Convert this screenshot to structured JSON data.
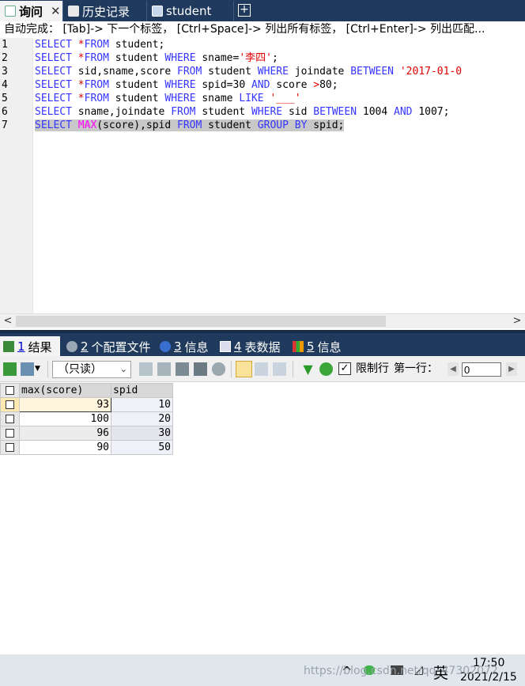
{
  "tabs": [
    {
      "label": "询问",
      "close": "✕"
    },
    {
      "label": "历史记录"
    },
    {
      "label": "student"
    }
  ],
  "add_tab": "+",
  "hint": "自动完成： [Tab]-> 下一个标签， [Ctrl+Space]-> 列出所有标签， [Ctrl+Enter]-> 列出匹配...",
  "editor": {
    "line_numbers": [
      "1",
      "2",
      "3",
      "4",
      "5",
      "6",
      "7"
    ],
    "lines": [
      [
        {
          "t": "SELECT ",
          "k": "kw"
        },
        {
          "t": "*",
          "k": "str"
        },
        {
          "t": "FROM ",
          "k": "kw"
        },
        {
          "t": "student;",
          "k": "txt"
        }
      ],
      [
        {
          "t": "SELECT ",
          "k": "kw"
        },
        {
          "t": "*",
          "k": "str"
        },
        {
          "t": "FROM ",
          "k": "kw"
        },
        {
          "t": "student ",
          "k": "txt"
        },
        {
          "t": "WHERE ",
          "k": "kw"
        },
        {
          "t": "sname=",
          "k": "txt"
        },
        {
          "t": "'李四'",
          "k": "str"
        },
        {
          "t": ";",
          "k": "txt"
        }
      ],
      [
        {
          "t": "SELECT ",
          "k": "kw"
        },
        {
          "t": "sid,sname,score ",
          "k": "txt"
        },
        {
          "t": "FROM ",
          "k": "kw"
        },
        {
          "t": "student ",
          "k": "txt"
        },
        {
          "t": "WHERE ",
          "k": "kw"
        },
        {
          "t": "joindate ",
          "k": "txt"
        },
        {
          "t": "BETWEEN ",
          "k": "kw"
        },
        {
          "t": "'2017-01-0",
          "k": "str"
        }
      ],
      [
        {
          "t": "SELECT ",
          "k": "kw"
        },
        {
          "t": "*",
          "k": "str"
        },
        {
          "t": "FROM ",
          "k": "kw"
        },
        {
          "t": "student ",
          "k": "txt"
        },
        {
          "t": "WHERE ",
          "k": "kw"
        },
        {
          "t": "spid=30 ",
          "k": "txt"
        },
        {
          "t": "AND ",
          "k": "kw"
        },
        {
          "t": "score ",
          "k": "txt"
        },
        {
          "t": ">",
          "k": "str"
        },
        {
          "t": "80;",
          "k": "txt"
        }
      ],
      [
        {
          "t": "SELECT ",
          "k": "kw"
        },
        {
          "t": "*",
          "k": "str"
        },
        {
          "t": "FROM ",
          "k": "kw"
        },
        {
          "t": "student ",
          "k": "txt"
        },
        {
          "t": "WHERE ",
          "k": "kw"
        },
        {
          "t": "sname ",
          "k": "txt"
        },
        {
          "t": "LIKE ",
          "k": "kw"
        },
        {
          "t": "'___'",
          "k": "str"
        }
      ],
      [
        {
          "t": "SELECT ",
          "k": "kw"
        },
        {
          "t": "sname,joindate ",
          "k": "txt"
        },
        {
          "t": "FROM ",
          "k": "kw"
        },
        {
          "t": "student ",
          "k": "txt"
        },
        {
          "t": "WHERE ",
          "k": "kw"
        },
        {
          "t": "sid ",
          "k": "txt"
        },
        {
          "t": "BETWEEN ",
          "k": "kw"
        },
        {
          "t": "1004 ",
          "k": "txt"
        },
        {
          "t": "AND ",
          "k": "kw"
        },
        {
          "t": "1007;",
          "k": "txt"
        }
      ],
      [
        {
          "t": "SELECT ",
          "k": "kw"
        },
        {
          "t": "MAX",
          "k": "fn"
        },
        {
          "t": "(score),spid ",
          "k": "txt"
        },
        {
          "t": "FROM ",
          "k": "kw"
        },
        {
          "t": "student ",
          "k": "txt"
        },
        {
          "t": "GROUP BY ",
          "k": "kw"
        },
        {
          "t": "spid;",
          "k": "txt"
        }
      ]
    ],
    "selected_line": 7
  },
  "scroll": {
    "left": "<",
    "right": ">"
  },
  "result_tabs": [
    {
      "num": "1",
      "label": "结果"
    },
    {
      "num": "2",
      "label": "个配置文件"
    },
    {
      "num": "3",
      "label": "信息"
    },
    {
      "num": "4",
      "label": "表数据"
    },
    {
      "num": "5",
      "label": "信息"
    }
  ],
  "toolbar": {
    "mode": "（只读）",
    "limit_label": "限制行",
    "first_row_label": "第一行：",
    "first_row_value": "0",
    "limit_checked": true
  },
  "grid": {
    "columns": [
      "max(score)",
      "spid"
    ],
    "rows": [
      [
        "93",
        "10"
      ],
      [
        "100",
        "20"
      ],
      [
        "96",
        "30"
      ],
      [
        "90",
        "50"
      ]
    ]
  },
  "taskbar": {
    "time": "17:50",
    "date": "2021/2/15",
    "ime": "英",
    "watermark": "https://blog.csdn.net/qq_47302072"
  },
  "colors": {
    "tab_bg": "#1f3a5c",
    "keyword": "#3535ff",
    "string": "#e00000",
    "function": "#ff00ff"
  }
}
